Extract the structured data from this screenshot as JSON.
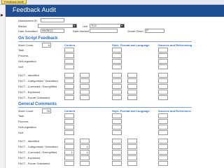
{
  "tab": {
    "label": "Feedback Audit"
  },
  "header": {
    "title": "Feedback Audit"
  },
  "record_selector": "▶",
  "form": {
    "assessment_id_label": "Assessment ID",
    "assessment_id_value": "",
    "marker_label": "Marker",
    "marker_value": "",
    "unit_label": "Unit",
    "unit_value": "TLG",
    "date_submitted_label": "Date Submitted",
    "date_submitted_value": "06/06/12",
    "date_marked_label": "Date Marked",
    "date_marked_value": "",
    "grade_given_label": "Grade Given",
    "grade_given_value": "P"
  },
  "sections": [
    {
      "title": "On Script Feedback",
      "word_count_label": "Word Count",
      "word_count_value": "6",
      "columns": [
        "Content",
        "Style, Format and Language",
        "Sources and Referencing"
      ],
      "rows": [
        "Task",
        "Process",
        "Self-regulation",
        "Self",
        "FACT - Identified",
        "FACT - Categorised / Described",
        "FACT - Corrected / Exemplified",
        "FACT - Explained",
        "FACT - Future Orientated"
      ],
      "values": []
    },
    {
      "title": "General Comments",
      "word_count_label": "Word Count",
      "word_count_value": "76",
      "columns": [
        "Content",
        "Style, Format and Language",
        "Sources and References"
      ],
      "rows": [
        "Task",
        "Process",
        "Self-regulation",
        "Self",
        "FACT - Identified",
        "FACT - Categorised / Described",
        "FACT - Corrected / Exemplified",
        "FACT - Explained",
        "FACT - Future Orientated"
      ],
      "values": [
        {
          "row": 5,
          "box": 1,
          "value": "1"
        },
        {
          "row": 6,
          "box": 0,
          "value": "1"
        },
        {
          "row": 6,
          "box": 1,
          "value": "1"
        }
      ]
    }
  ]
}
